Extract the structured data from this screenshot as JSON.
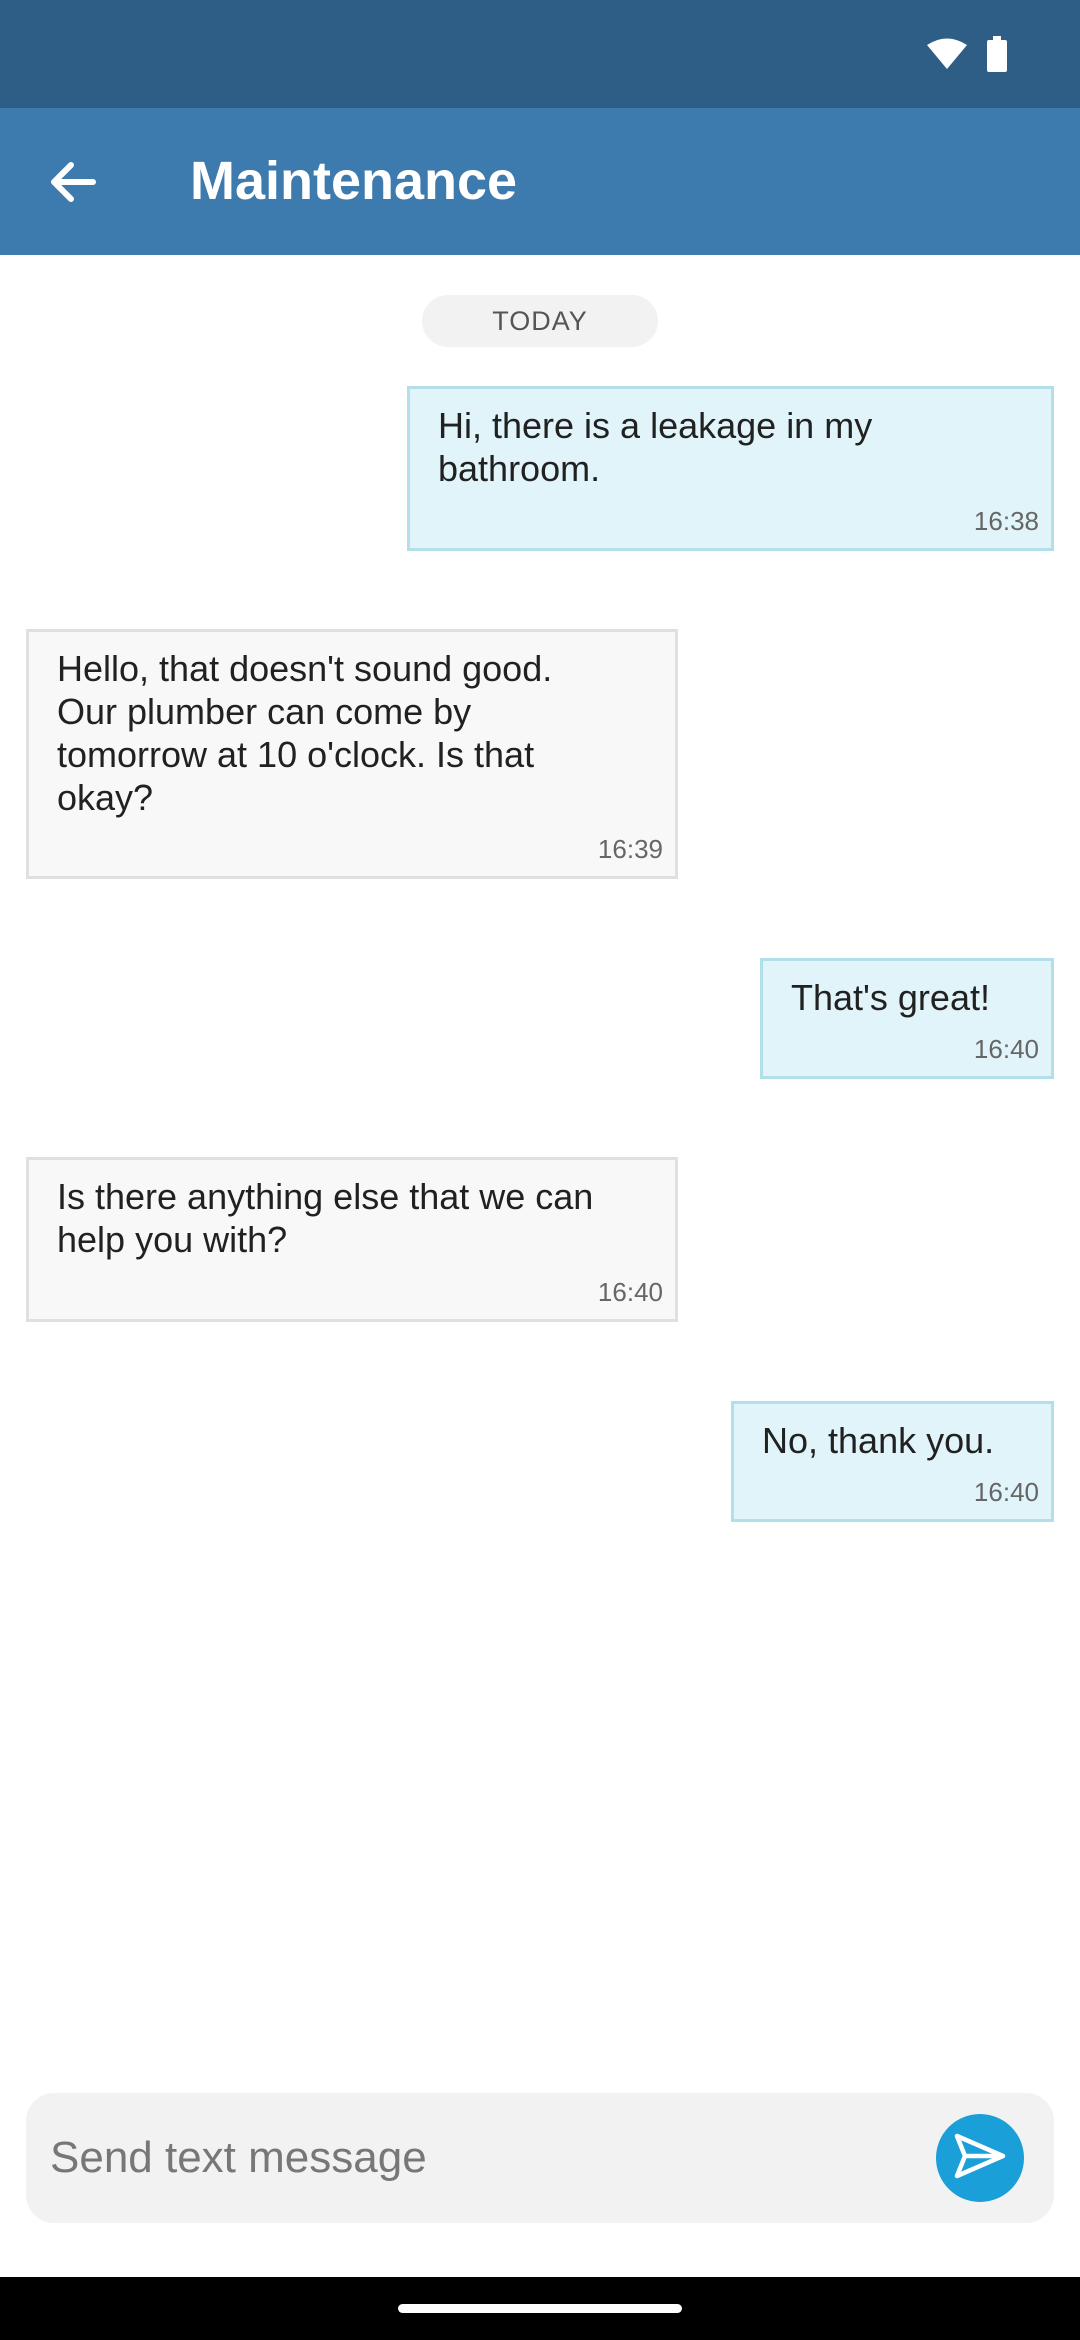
{
  "status_bar": {
    "icons": [
      "wifi-icon",
      "battery-icon"
    ],
    "background": "#2e5e86"
  },
  "app_bar": {
    "title": "Maintenance",
    "back_icon": "arrow-left-icon",
    "background": "#3d7aae"
  },
  "chat": {
    "date_chip": "TODAY",
    "messages": [
      {
        "direction": "outgoing",
        "text": "Hi, there is a leakage in my\nbathroom.",
        "time": "16:38"
      },
      {
        "direction": "incoming",
        "text": "Hello, that doesn't sound good.\nOur plumber can come by\ntomorrow at 10 o'clock. Is that\nokay?",
        "time": "16:39"
      },
      {
        "direction": "outgoing",
        "text": "That's great!",
        "time": "16:40"
      },
      {
        "direction": "incoming",
        "text": "Is there anything else that we can\nhelp you with?",
        "time": "16:40"
      },
      {
        "direction": "outgoing",
        "text": "No, thank you.",
        "time": "16:40"
      }
    ]
  },
  "composer": {
    "placeholder": "Send text message",
    "value": "",
    "send_icon": "send-icon",
    "accent": "#1a9fd8"
  },
  "colors": {
    "outgoing_bubble": "#e0f4f9",
    "incoming_bubble": "#f8f8f8"
  }
}
